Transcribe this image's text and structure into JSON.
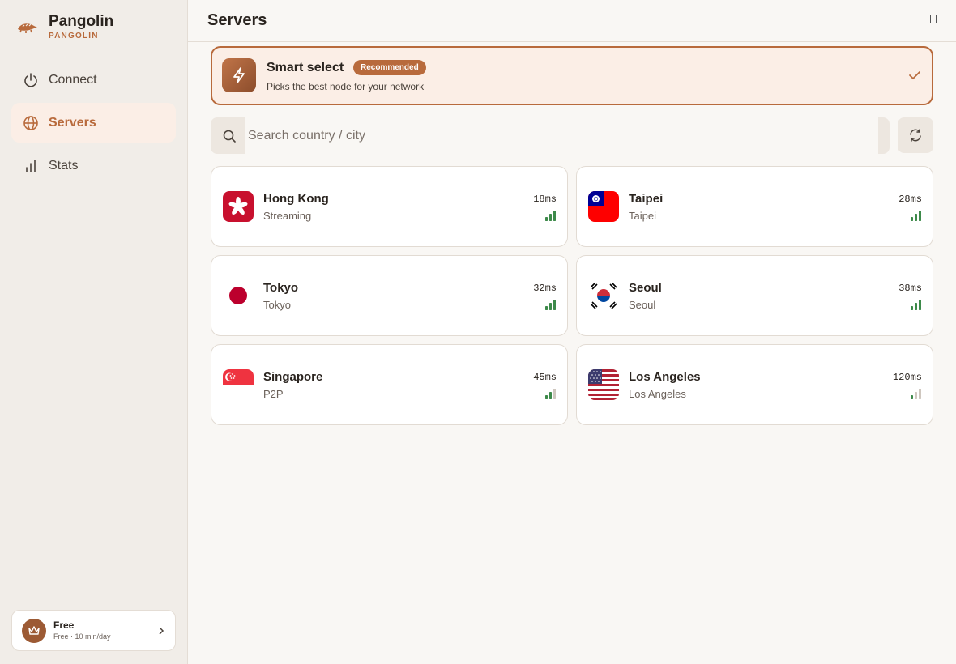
{
  "app": {
    "name": "Pangolin",
    "subtitle": "PANGOLIN",
    "logo_icon": "pangolin-logo-icon"
  },
  "nav": [
    {
      "label": "Connect",
      "icon": "power-icon",
      "active": false
    },
    {
      "label": "Servers",
      "icon": "globe-icon",
      "active": true
    },
    {
      "label": "Stats",
      "icon": "bar-chart-icon",
      "active": false
    }
  ],
  "plan": {
    "title": "Free",
    "subtitle": "Free · 10 min/day",
    "icon": "crown-icon"
  },
  "header": {
    "title": "Servers"
  },
  "smart_select": {
    "title": "Smart select",
    "badge": "Recommended",
    "subtitle": "Picks the best node for your network",
    "selected": true
  },
  "search": {
    "placeholder": "Search country / city",
    "value": ""
  },
  "servers": [
    {
      "city": "Hong Kong",
      "tag": "Streaming",
      "latency": "18ms",
      "signal_bars": 3,
      "flag": "hk-flag"
    },
    {
      "city": "Taipei",
      "tag": "Taipei",
      "latency": "28ms",
      "signal_bars": 3,
      "flag": "tw-flag"
    },
    {
      "city": "Tokyo",
      "tag": "Tokyo",
      "latency": "32ms",
      "signal_bars": 3,
      "flag": "jp-flag"
    },
    {
      "city": "Seoul",
      "tag": "Seoul",
      "latency": "38ms",
      "signal_bars": 3,
      "flag": "kr-flag"
    },
    {
      "city": "Singapore",
      "tag": "P2P",
      "latency": "45ms",
      "signal_bars": 2,
      "flag": "sg-flag"
    },
    {
      "city": "Los Angeles",
      "tag": "Los Angeles",
      "latency": "120ms",
      "signal_bars": 1,
      "flag": "us-flag"
    }
  ],
  "colors": {
    "accent": "#b86a3c",
    "signal_on": "#3d8a4a",
    "signal_off": "#cfc7bf"
  }
}
